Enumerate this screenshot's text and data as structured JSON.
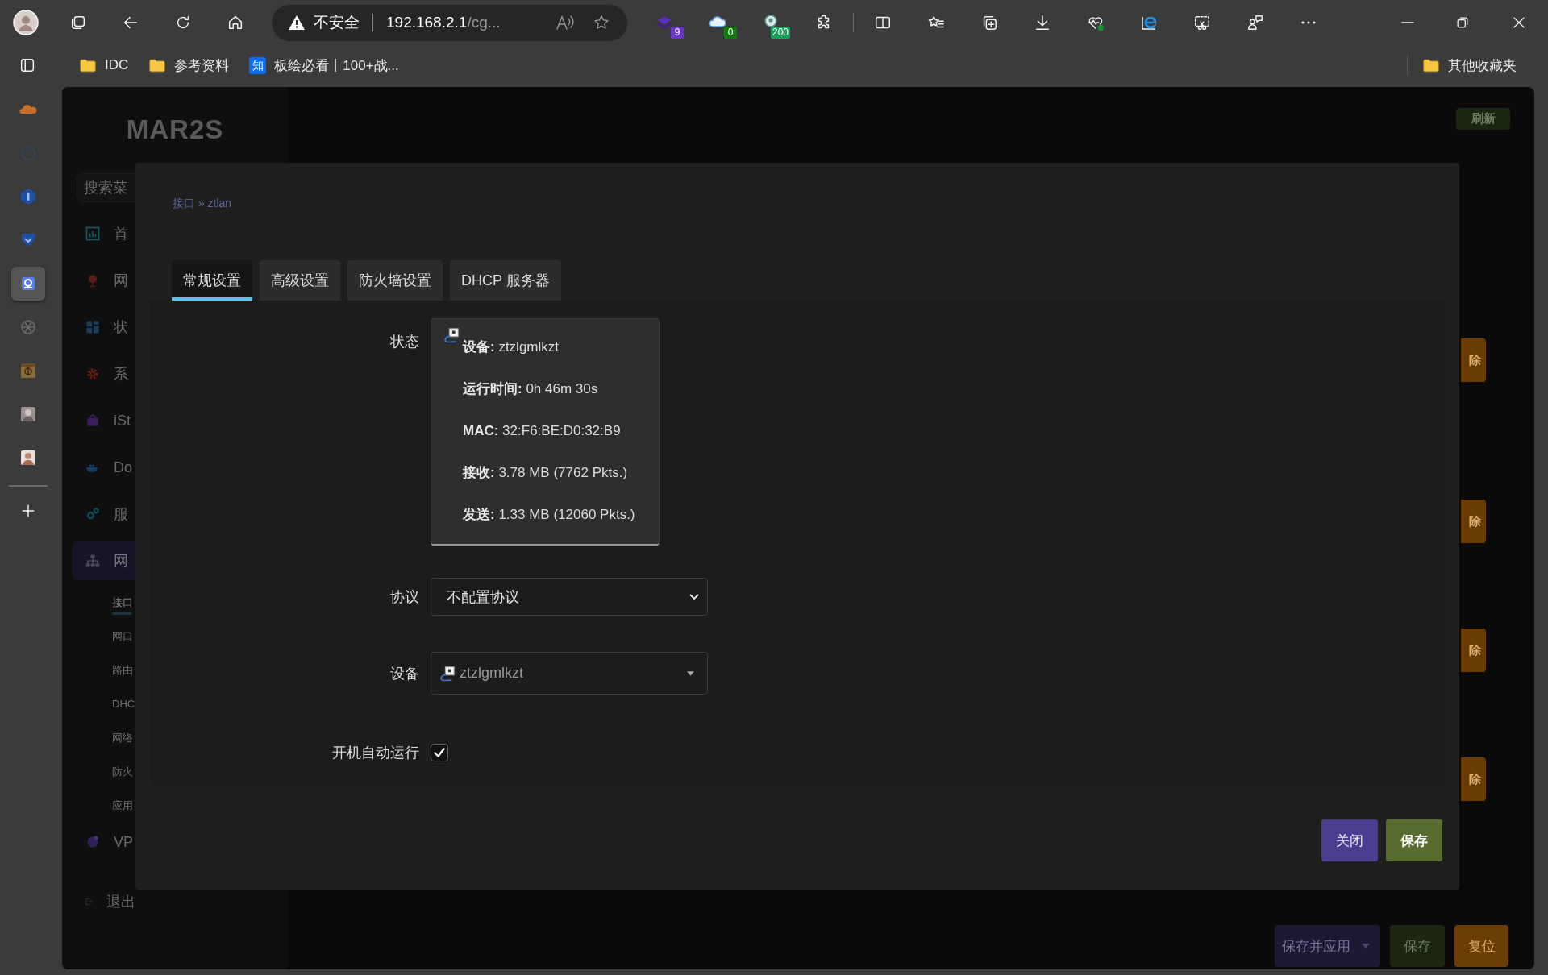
{
  "browser": {
    "security": "不安全",
    "url_host": "192.168.2.1",
    "url_rest": "/cg...",
    "extensions": [
      {
        "badge": "9",
        "color": "#6a35c9"
      },
      {
        "badge": "0",
        "color": "#0f7b0f"
      },
      {
        "badge": "200",
        "color": "#16a05a"
      }
    ],
    "bookmarks": [
      {
        "label": "IDC",
        "kind": "folder"
      },
      {
        "label": "参考资料",
        "kind": "folder"
      },
      {
        "label": "板绘必看丨100+战...",
        "kind": "site",
        "badge": "知"
      }
    ],
    "other_bookmarks": "其他收藏夹",
    "sidebar_apps": [
      {
        "selected": false
      },
      {
        "selected": false
      },
      {
        "selected": false
      },
      {
        "selected": false
      },
      {
        "selected": true
      },
      {
        "selected": false
      },
      {
        "selected": false
      },
      {
        "selected": false
      },
      {
        "selected": false
      }
    ]
  },
  "page": {
    "logo": "MAR2S",
    "search_placeholder": "搜索菜",
    "nav": [
      {
        "label": "首",
        "selected": false
      },
      {
        "label": "网",
        "selected": false
      },
      {
        "label": "状",
        "selected": false
      },
      {
        "label": "系",
        "selected": false
      },
      {
        "label": "iSt",
        "selected": false
      },
      {
        "label": "Do",
        "selected": false
      },
      {
        "label": "服",
        "selected": false
      },
      {
        "label": "网",
        "selected": true,
        "children": [
          {
            "label": "接口",
            "selected": true
          },
          {
            "label": "网口",
            "selected": false
          },
          {
            "label": "路由",
            "selected": false
          },
          {
            "label": "DHC",
            "selected": false
          },
          {
            "label": "网络",
            "selected": false
          },
          {
            "label": "防火",
            "selected": false
          },
          {
            "label": "应用",
            "selected": false
          }
        ]
      },
      {
        "label": "VP",
        "selected": false
      },
      {
        "label": "退出",
        "selected": false
      }
    ],
    "refresh_button": "刷新",
    "row_buttons": [
      "除",
      "除",
      "除",
      "除"
    ],
    "actions": [
      {
        "label": "保存并应用",
        "kind": "split"
      },
      {
        "label": "保存",
        "kind": "save"
      },
      {
        "label": "复位",
        "kind": "reset"
      }
    ]
  },
  "dialog": {
    "breadcrumb": "接口 » ztlan",
    "tabs": [
      {
        "label": "常规设置",
        "selected": true
      },
      {
        "label": "高级设置",
        "selected": false
      },
      {
        "label": "防火墙设置",
        "selected": false
      },
      {
        "label": "DHCP 服务器",
        "selected": false
      }
    ],
    "fields": [
      {
        "kind": "status",
        "label": "状态",
        "lines": [
          "**设备:** ztzlgmlkzt",
          "**运行时间:** 0h 46m 30s",
          "**MAC:** 32:F6:BE:D0:32:B9",
          "**接收:** 3.78 MB (7762 Pkts.)",
          "**发送:** 1.33 MB (12060 Pkts.)"
        ]
      },
      {
        "kind": "select",
        "label": "协议",
        "value": "不配置协议"
      },
      {
        "kind": "device",
        "label": "设备",
        "value": "ztzlgmlkzt"
      },
      {
        "kind": "checkbox",
        "label": "开机自动运行",
        "checked": true
      }
    ],
    "buttons": [
      {
        "label": "关闭",
        "kind": "close"
      },
      {
        "label": "保存",
        "kind": "save"
      }
    ]
  }
}
